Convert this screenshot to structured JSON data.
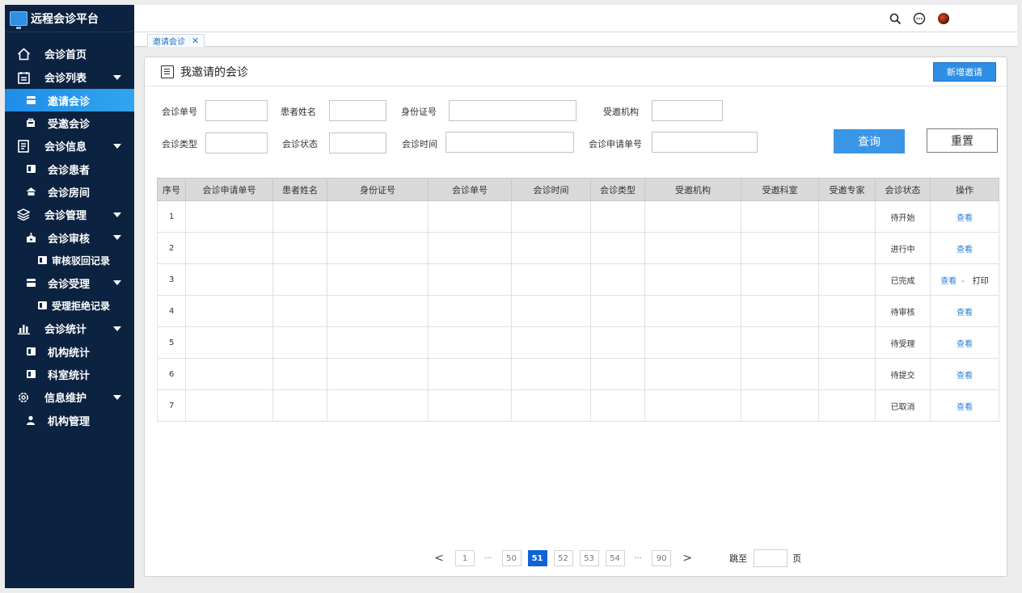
{
  "app": {
    "title": "远程会诊平台"
  },
  "sidebar": {
    "items": [
      {
        "label": "会诊首页",
        "icon": "home-icon"
      },
      {
        "label": "会诊列表",
        "icon": "calendar-icon"
      },
      {
        "label": "邀请会诊",
        "icon": "card-icon",
        "active": true
      },
      {
        "label": "受邀会诊",
        "icon": "bag-icon"
      },
      {
        "label": "会诊信息",
        "icon": "document-icon"
      },
      {
        "label": "会诊患者",
        "icon": "patient-icon"
      },
      {
        "label": "会诊房间",
        "icon": "house-icon"
      },
      {
        "label": "会诊管理",
        "icon": "layers-icon"
      },
      {
        "label": "会诊审核",
        "icon": "download-box-icon"
      },
      {
        "label": "审核驳回记录",
        "icon": "record-icon"
      },
      {
        "label": "会诊受理",
        "icon": "card-icon"
      },
      {
        "label": "受理拒绝记录",
        "icon": "record-icon"
      },
      {
        "label": "会诊统计",
        "icon": "bar-chart-icon"
      },
      {
        "label": "机构统计",
        "icon": "stats-icon"
      },
      {
        "label": "科室统计",
        "icon": "stats-icon"
      },
      {
        "label": "信息维护",
        "icon": "gear-icon"
      },
      {
        "label": "机构管理",
        "icon": "user-icon"
      }
    ]
  },
  "tabs": [
    {
      "label": "邀请会诊"
    }
  ],
  "panel": {
    "title": "我邀请的会诊",
    "new_button": "新增邀请"
  },
  "filters": {
    "consult_no": "会诊单号",
    "patient_name": "患者姓名",
    "id_no": "身份证号",
    "invited_org": "受邀机构",
    "consult_type": "会诊类型",
    "consult_status": "会诊状态",
    "consult_time": "会诊时间",
    "apply_no": "会诊申请单号",
    "query_button": "查询",
    "reset_button": "重置"
  },
  "table": {
    "headers": [
      "序号",
      "会诊申请单号",
      "患者姓名",
      "身份证号",
      "会诊单号",
      "会诊时间",
      "会诊类型",
      "受邀机构",
      "受邀科室",
      "受邀专家",
      "会诊状态",
      "操作"
    ],
    "rows": [
      {
        "seq": "1",
        "status": "待开始",
        "op": "查看"
      },
      {
        "seq": "2",
        "status": "进行中",
        "op": "查看"
      },
      {
        "seq": "3",
        "status": "已完成",
        "op": "查看",
        "sep": "-",
        "op2": "打印"
      },
      {
        "seq": "4",
        "status": "待审核",
        "op": "查看"
      },
      {
        "seq": "5",
        "status": "待受理",
        "op": "查看"
      },
      {
        "seq": "6",
        "status": "待提交",
        "op": "查看"
      },
      {
        "seq": "7",
        "status": "已取消",
        "op": "查看"
      }
    ]
  },
  "pagination": {
    "prev": "<",
    "next": ">",
    "pages": [
      "1",
      "···",
      "50",
      "51",
      "52",
      "53",
      "54",
      "···",
      "90"
    ],
    "current": "51",
    "jump_label": "跳至",
    "page_unit": "页"
  }
}
